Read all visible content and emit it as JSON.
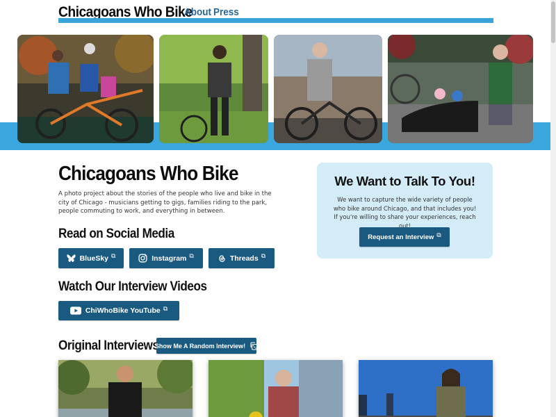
{
  "header": {
    "site_title": "Chicagoans Who Bike",
    "nav": [
      {
        "label": "About"
      },
      {
        "label": "Press"
      }
    ]
  },
  "hero_photos": [
    {
      "subject": "family with cargo bike"
    },
    {
      "subject": "rider with bike in park"
    },
    {
      "subject": "older rider with bike"
    },
    {
      "subject": "woman with cargo bike and kids"
    }
  ],
  "intro": {
    "title": "Chicagoans Who Bike",
    "description": "A photo project about the stories of the people who live and bike in the city of Chicago - musicians getting to gigs, families riding to the park, people commuting to work, and everything in between."
  },
  "social": {
    "heading": "Read on Social Media",
    "buttons": [
      {
        "label": "BlueSky",
        "icon": "butterfly-icon"
      },
      {
        "label": "Instagram",
        "icon": "instagram-icon"
      },
      {
        "label": "Threads",
        "icon": "threads-icon"
      }
    ],
    "external_glyph": "⧉"
  },
  "videos": {
    "heading": "Watch Our Interview Videos",
    "button_label": "ChiWhoBike YouTube",
    "icon": "youtube-icon"
  },
  "talk": {
    "title": "We Want to Talk To You!",
    "text": "We want to capture the wide variety of people who bike around Chicago, and that includes you! If you're willing to share your experiences, reach out!",
    "button_label": "Request an Interview"
  },
  "original": {
    "heading": "Original Interviews",
    "random_button_label": "Show Me A Random Interview!",
    "icon": "dice-icon"
  },
  "colors": {
    "accent_blue": "#3aa8de",
    "button_blue": "#1b5a80",
    "nav_blue": "#2a6796",
    "card_bg": "#d3ecf7"
  }
}
